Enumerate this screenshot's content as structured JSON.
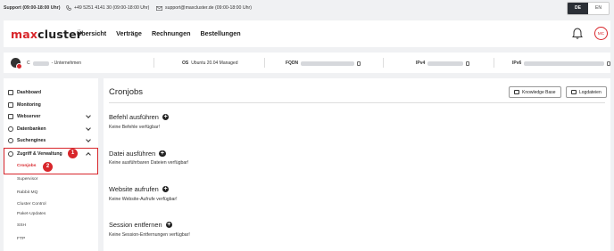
{
  "topbar": {
    "support_label": "Support (09:00-18:00 Uhr)",
    "phone": "+49 5251 4141 30 (09:00-18:00 Uhr)",
    "email": "support@maxcluster.de (09:00-18:00 Uhr)",
    "lang_de": "DE",
    "lang_en": "EN"
  },
  "nav": {
    "logo_max": "max",
    "logo_cluster": "cluster",
    "items": [
      "Übersicht",
      "Verträge",
      "Rechnungen",
      "Bestellungen"
    ],
    "avatar": "MC"
  },
  "infobar": {
    "cluster_prefix": "C",
    "company": "- Unternehmen",
    "os_label": "OS",
    "os_value": "Ubuntu 20.04 Managed",
    "fqdn_label": "FQDN",
    "ipv4_label": "IPv4",
    "ipv6_label": "IPv6"
  },
  "sidebar": {
    "items": [
      {
        "label": "Dashboard",
        "icon": "dashboard-icon"
      },
      {
        "label": "Monitoring",
        "icon": "monitoring-icon"
      },
      {
        "label": "Webserver",
        "icon": "webserver-icon"
      },
      {
        "label": "Datenbanken",
        "icon": "database-icon"
      },
      {
        "label": "Suchengines",
        "icon": "search-icon"
      },
      {
        "label": "Zugriff & Verwaltung",
        "icon": "key-icon"
      }
    ],
    "subitems": [
      "Cronjobs",
      "Supervisor",
      "Rabbit MQ",
      "Cluster Control",
      "Paket-Updates",
      "SSH",
      "FTP"
    ],
    "badge1": "1",
    "badge2": "2"
  },
  "main": {
    "title": "Cronjobs",
    "knowledge_base": "Knowledge Base",
    "logdateien": "Logdateien",
    "sections": [
      {
        "title": "Befehl ausführen",
        "empty": "Keine Befehle verfügbar!"
      },
      {
        "title": "Datei ausführen",
        "empty": "Keine ausführbaren Dateien verfügbar!"
      },
      {
        "title": "Website aufrufen",
        "empty": "Keine Website-Aufrufe verfügbar!"
      },
      {
        "title": "Session entfernen",
        "empty": "Keine Session-Entfernungen verfügbar!"
      }
    ]
  },
  "colors": {
    "brand_red": "#d8262b",
    "dark": "#2b2f36",
    "background": "#f0f1f3"
  }
}
